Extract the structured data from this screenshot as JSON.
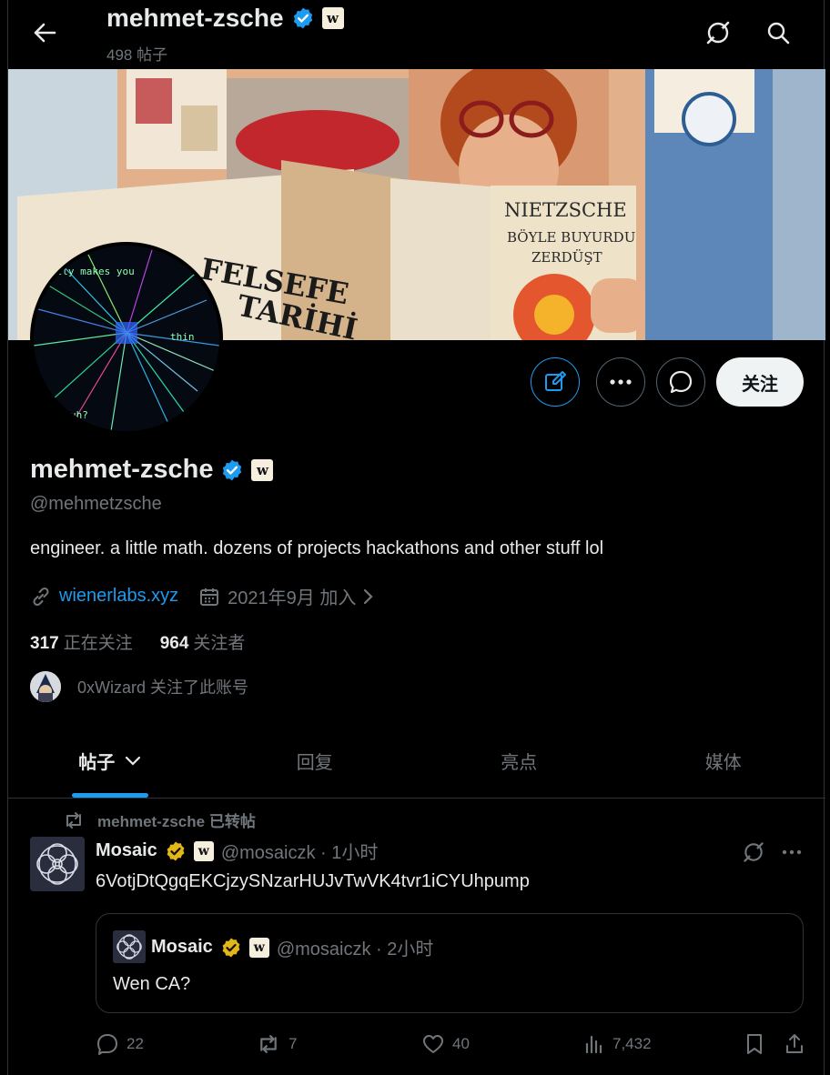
{
  "header": {
    "title": "mehmet-zsche",
    "post_count": "498 帖子"
  },
  "icons": {
    "back": "arrow-left-icon",
    "grok": "grok-slash-icon",
    "search": "search-icon",
    "verified": "verified-badge-icon",
    "org_badge": "w-org-badge-icon"
  },
  "profile": {
    "name": "mehmet-zsche",
    "handle": "@mehmetzsche",
    "bio": "engineer. a little math. dozens of projects hackathons and other stuff lol",
    "website": "wienerlabs.xyz",
    "joined": "2021年9月 加入",
    "following_count": "317",
    "following_label": "正在关注",
    "followers_count": "964",
    "followers_label": "关注者",
    "followed_by": "0xWizard 关注了此账号",
    "follow_button": "关注",
    "badge_letter": "w"
  },
  "banner_text": {
    "book_left_1": "FELSEFE",
    "book_left_2": "TARİHİ",
    "book_right_1": "NIETZSCHE",
    "book_right_2": "BÖYLE BUYURDU",
    "book_right_3": "ZERDÜŞT"
  },
  "avatar_text": {
    "line1": "ally makes you",
    "line2": "thin",
    "line3": "uh?"
  },
  "tabs": [
    {
      "label": "帖子",
      "active": true
    },
    {
      "label": "回复",
      "active": false
    },
    {
      "label": "亮点",
      "active": false
    },
    {
      "label": "媒体",
      "active": false
    }
  ],
  "post": {
    "repost_label": "mehmet-zsche 已转帖",
    "author": "Mosaic",
    "handle_time": "@mosaiczk · 1小时",
    "text": "6VotjDtQgqEKCjzySNzarHUJvTwVK4tvr1iCYUhpump",
    "quote": {
      "author": "Mosaic",
      "handle_time": "@mosaiczk · 2小时",
      "text": "Wen CA?"
    },
    "stats": {
      "replies": "22",
      "reposts": "7",
      "likes": "40",
      "views": "7,432"
    }
  },
  "colors": {
    "accent": "#1d9bf0",
    "verified_blue": "#1d9bf0",
    "verified_gold": "#e2b719",
    "muted": "#71767b",
    "background": "#000000"
  }
}
